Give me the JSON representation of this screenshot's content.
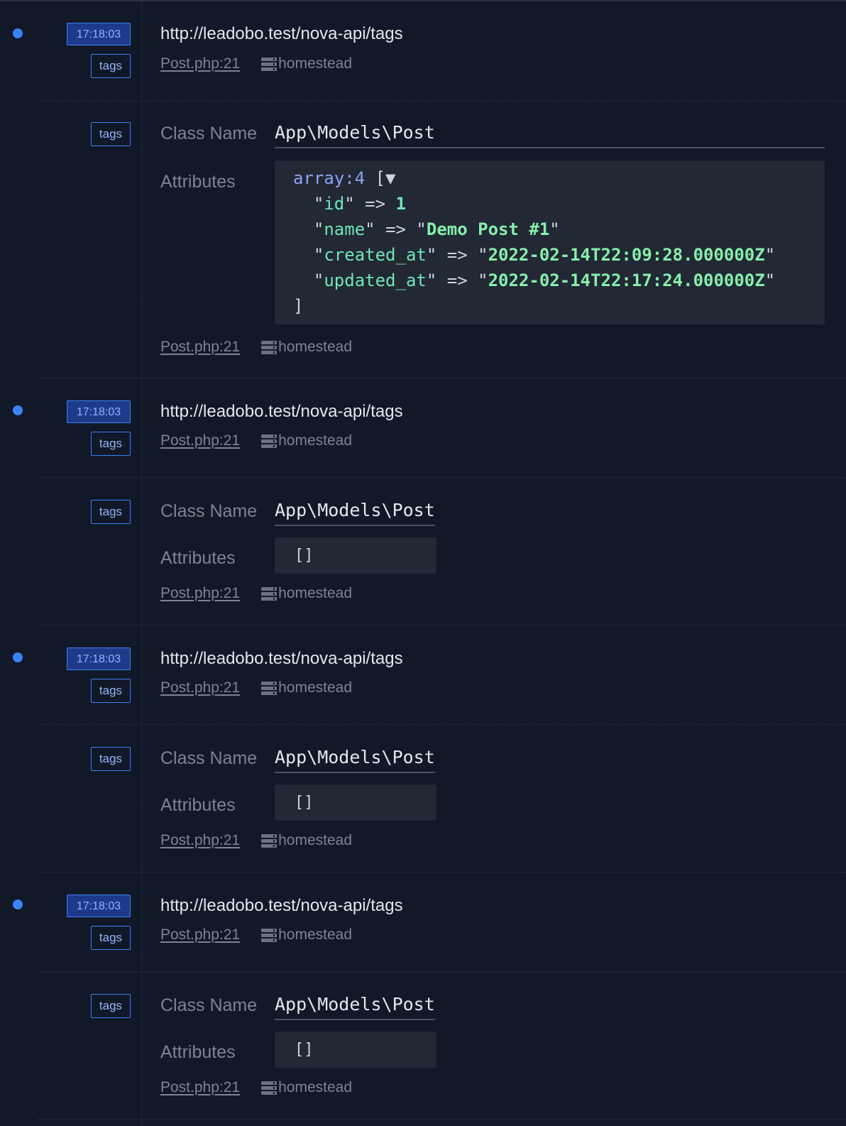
{
  "entries": [
    {
      "time": "17:18:03",
      "tag": "tags",
      "url": "http://leadobo.test/nova-api/tags",
      "file": "Post.php:21",
      "host": "homestead"
    },
    {
      "time": "17:18:03",
      "tag": "tags",
      "url": "http://leadobo.test/nova-api/tags",
      "file": "Post.php:21",
      "host": "homestead"
    },
    {
      "time": "17:18:03",
      "tag": "tags",
      "url": "http://leadobo.test/nova-api/tags",
      "file": "Post.php:21",
      "host": "homestead"
    },
    {
      "time": "17:18:03",
      "tag": "tags",
      "url": "http://leadobo.test/nova-api/tags",
      "file": "Post.php:21",
      "host": "homestead"
    }
  ],
  "models": [
    {
      "tag": "tags",
      "class_label": "Class Name",
      "class_name": "App\\Models\\Post",
      "attributes_label": "Attributes",
      "file": "Post.php:21",
      "host": "homestead",
      "attributes": {
        "header": "array:4",
        "open": "[▼",
        "close": "]",
        "rows": [
          {
            "key": "id",
            "value": "1",
            "type": "number"
          },
          {
            "key": "name",
            "value": "Demo Post #1",
            "type": "string"
          },
          {
            "key": "created_at",
            "value": "2022-02-14T22:09:28.000000Z",
            "type": "string"
          },
          {
            "key": "updated_at",
            "value": "2022-02-14T22:17:24.000000Z",
            "type": "string"
          }
        ]
      }
    },
    {
      "tag": "tags",
      "class_label": "Class Name",
      "class_name": "App\\Models\\Post",
      "attributes_label": "Attributes",
      "file": "Post.php:21",
      "host": "homestead",
      "attributes_empty": "[]"
    },
    {
      "tag": "tags",
      "class_label": "Class Name",
      "class_name": "App\\Models\\Post",
      "attributes_label": "Attributes",
      "file": "Post.php:21",
      "host": "homestead",
      "attributes_empty": "[]"
    },
    {
      "tag": "tags",
      "class_label": "Class Name",
      "class_name": "App\\Models\\Post",
      "attributes_label": "Attributes",
      "file": "Post.php:21",
      "host": "homestead",
      "attributes_empty": "[]"
    }
  ],
  "colors": {
    "background": "#111827",
    "accent": "#3b82f6",
    "badge_fill": "#1e3a8a",
    "string_value": "#86efac",
    "array_header": "#8ea3f5"
  }
}
